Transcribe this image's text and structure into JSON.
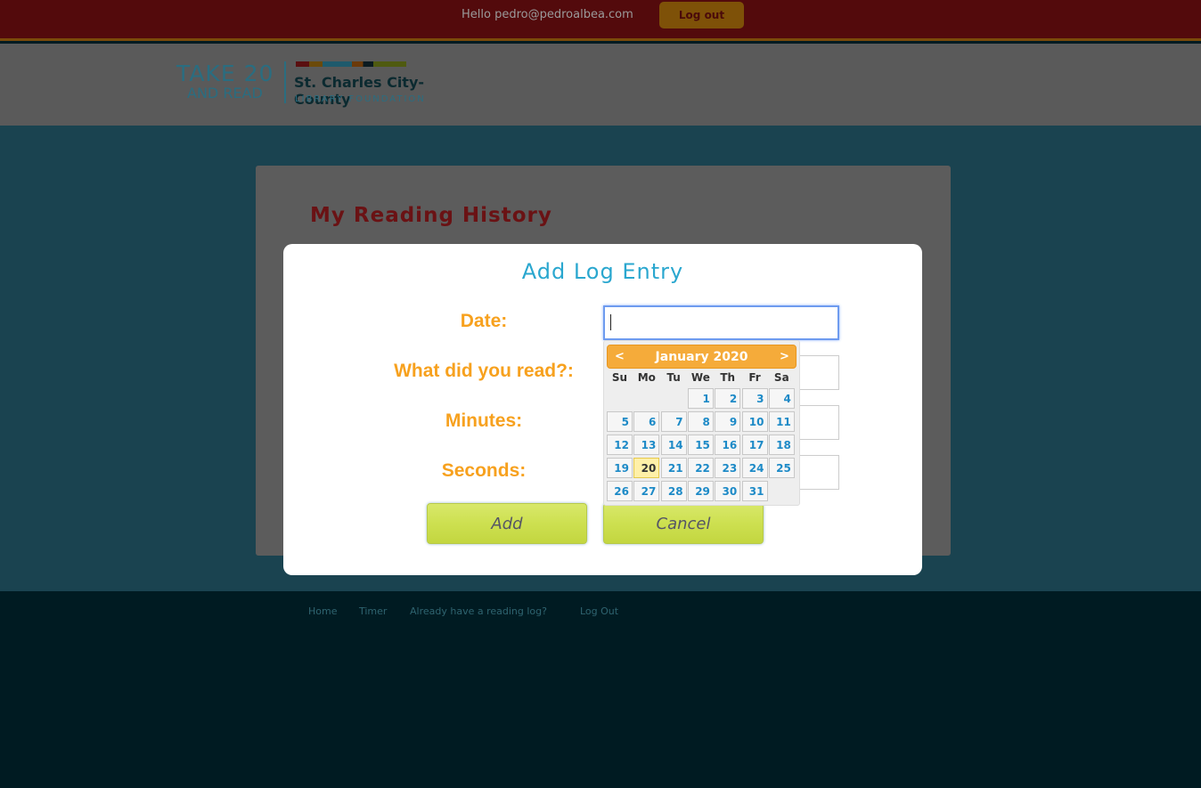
{
  "topbar": {
    "greeting": "Hello pedro@pedroalbea.com",
    "logout_label": "Log out"
  },
  "logo": {
    "line1": "TAKE 20",
    "line2": "AND READ",
    "org": "St. Charles City-County",
    "sub": "LIBRARY FOUNDATION"
  },
  "page": {
    "title": "My Reading History"
  },
  "modal": {
    "title": "Add Log Entry",
    "fields": [
      {
        "label": "Date:",
        "value": ""
      },
      {
        "label": "What did you read?:",
        "value": ""
      },
      {
        "label": "Minutes:",
        "value": ""
      },
      {
        "label": "Seconds:",
        "value": ""
      }
    ],
    "add_label": "Add",
    "cancel_label": "Cancel"
  },
  "datepicker": {
    "month": "January 2020",
    "prev": "<",
    "next": ">",
    "weekdays": [
      "Su",
      "Mo",
      "Tu",
      "We",
      "Th",
      "Fr",
      "Sa"
    ],
    "first_weekday_index": 3,
    "days_in_month": 31,
    "highlighted_day": 20
  },
  "footer": {
    "links": [
      "Home",
      "Timer",
      "Already have a reading log?",
      "Log Out"
    ]
  }
}
